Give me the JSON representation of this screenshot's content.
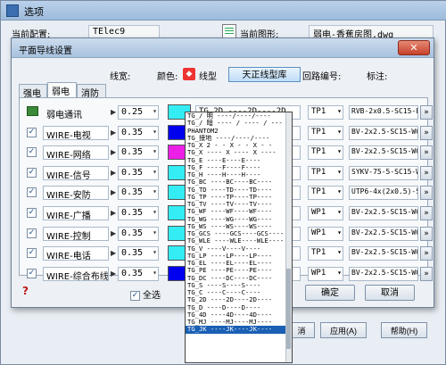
{
  "outer": {
    "title": "选项",
    "current_config_label": "当前配置:",
    "current_config_value": "TElec9",
    "current_drawing_label": "当前图形:",
    "current_drawing_value": "弱电-香蕉房图.dwg"
  },
  "dialog": {
    "title": "平面导线设置",
    "close_glyph": "✕",
    "headers": {
      "width": "线宽:",
      "color": "颜色:",
      "linetype": "线型",
      "linetype_lib": "天正线型库",
      "loop_no": "回路编号:",
      "label": "标注:"
    },
    "tabs": [
      "强电",
      "弱电",
      "消防"
    ],
    "active_tab": 1,
    "rows": [
      {
        "name": "弱电通讯",
        "checked": false,
        "width": "0.25",
        "color": "#33ecf4",
        "linetype": "TG_2D ----2D----2D",
        "loop": "TP1",
        "label": "RVB-2x0.5-SC15-FC"
      },
      {
        "name": "WIRE-电视",
        "checked": true,
        "width": "0.35",
        "color": "#0000ee",
        "linetype": "",
        "loop": "TP1",
        "label": "BV-2x2.5-SC15-WC"
      },
      {
        "name": "WIRE-网络",
        "checked": true,
        "width": "0.35",
        "color": "#ec1fe6",
        "linetype": "",
        "loop": "TP1",
        "label": "BV-2x2.5-SC15-WC"
      },
      {
        "name": "WIRE-信号",
        "checked": true,
        "width": "0.35",
        "color": "#33ecf4",
        "linetype": "",
        "loop": "TP1",
        "label": "SYKV-75-5-SC15-WC"
      },
      {
        "name": "WIRE-安防",
        "checked": true,
        "width": "0.35",
        "color": "#33ecf4",
        "linetype": "",
        "loop": "TP1",
        "label": "UTP6-4x(2x0.5)-SC"
      },
      {
        "name": "WIRE-广播",
        "checked": true,
        "width": "0.35",
        "color": "#33ecf4",
        "linetype": "",
        "loop": "WP1",
        "label": "BV-2x2.5-SC15-WC"
      },
      {
        "name": "WIRE-控制",
        "checked": true,
        "width": "0.35",
        "color": "#33ecf4",
        "linetype": "",
        "loop": "WP1",
        "label": "BV-2x2.5-SC15-WC"
      },
      {
        "name": "WIRE-电话",
        "checked": true,
        "width": "0.35",
        "color": "#33ecf4",
        "linetype": "",
        "loop": "TP1",
        "label": "BV-2x2.5-SC15-WC"
      },
      {
        "name": "WIRE-综合布线",
        "checked": true,
        "width": "0.35",
        "color": "#0000ee",
        "linetype": "",
        "loop": "WP1",
        "label": "BV-2x2.5-SC15-WC"
      }
    ],
    "select_all": "全选",
    "ok": "确定",
    "cancel": "取消",
    "more": "»",
    "help_glyph": "?"
  },
  "linetype_options": [
    "TG_/ 明 ----/----/----",
    "TG_/ 暗 ---- / ---- / ---",
    "PHANTOM2",
    "TG_接地 ----/----/----",
    "TG_X 2 - - X - - X - -",
    "TG_X ---- X ---- X ----",
    "TG_E ----E----E----",
    "TG_F ----F----F----",
    "TG_H ----H----H----",
    "TG_BC ----BC----BC----",
    "TG_TD ----TD----TD----",
    "TG_TP ----TP----TP----",
    "TG_TV ----TV----TV----",
    "TG_WF ----WF----WF----",
    "TG_WG ----WG----WG----",
    "TG_WS ----WS----WS----",
    "TG_GCS ----GCS----GCS----",
    "TG_WLE ----WLE----WLE----",
    "TG_V ----V----V----",
    "TG_LP ----LP----LP----",
    "TG_EL ----EL----EL----",
    "TG_PE ----PE----PE----",
    "TG_DC ----DC----DC----",
    "TG_S ----S----S----",
    "TG_C ----C----C----",
    "TG_2D ----2D----2D----",
    "TG_D ----D----D----",
    "TG_4D ----4D----4D----",
    "TG_MJ ----MJ----MJ----",
    "TG_JK ----JK----JK----"
  ],
  "linetype_selected_index": 29,
  "bottom": {
    "apply_partial": "应用(A)",
    "cancel_partial": "消",
    "help_partial": "帮助(H)"
  }
}
